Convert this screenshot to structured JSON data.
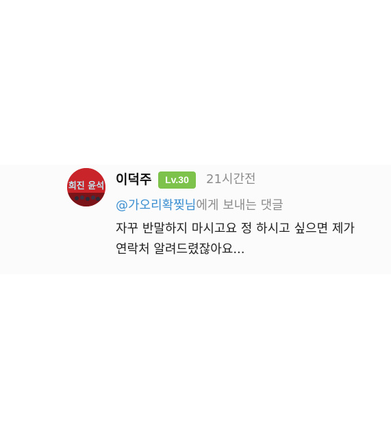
{
  "comment": {
    "author": "이덕주",
    "level_badge": "Lv.30",
    "time_ago": "21시간전",
    "reply_to": {
      "mention": "@가오리확찢님",
      "suffix": "에게 보내는 댓글"
    },
    "body_lines": [
      "자꾸 반말하지 마시고요 정 하시고 싶으면 제가",
      "연락처 알려드렸잖아요..."
    ],
    "avatar_text": "희진 윤석"
  },
  "colors": {
    "level_badge": "#7dc24a",
    "mention": "#3b8fd1",
    "meta_gray": "#8c8c8c",
    "avatar_red": "#c8242a",
    "comment_bg": "#fbfbfb"
  }
}
